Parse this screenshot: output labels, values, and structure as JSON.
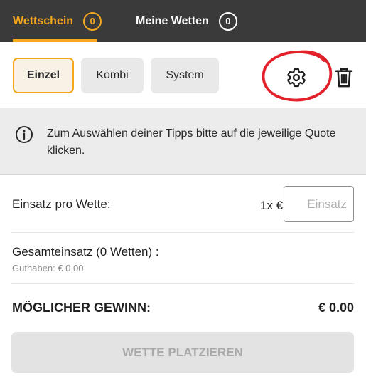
{
  "header": {
    "tabs": [
      {
        "label": "Wettschein",
        "count": "0",
        "active": true
      },
      {
        "label": "Meine Wetten",
        "count": "0",
        "active": false
      }
    ]
  },
  "bet_types": {
    "items": [
      {
        "label": "Einzel",
        "selected": true
      },
      {
        "label": "Kombi",
        "selected": false
      },
      {
        "label": "System",
        "selected": false
      }
    ],
    "settings_icon": "gear-icon",
    "delete_icon": "trash-icon"
  },
  "info": {
    "icon": "info-icon",
    "text": "Zum Auswählen deiner Tipps bitte auf die jeweilige Quote klicken."
  },
  "stake": {
    "label": "Einsatz pro Wette:",
    "multiplier": "1x €",
    "placeholder": "Einsatz",
    "value": ""
  },
  "total": {
    "label": "Gesamteinsatz (0 Wetten) :",
    "balance": "Guthaben: € 0,00"
  },
  "winnings": {
    "label": "MÖGLICHER GEWINN:",
    "value": "€ 0.00"
  },
  "submit": {
    "label": "WETTE PLATZIEREN",
    "enabled": false
  },
  "colors": {
    "accent": "#f4a81d",
    "header_bg": "#3a3a3a",
    "annotation": "#e3212b"
  }
}
